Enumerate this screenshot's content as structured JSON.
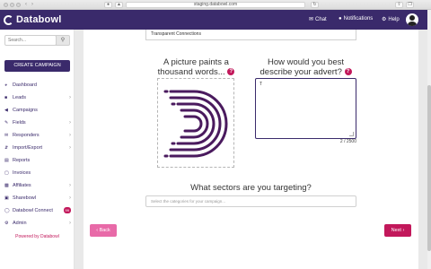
{
  "browser": {
    "url": "staging.databowl.com",
    "back_icon": "chevron-left-icon",
    "forward_icon": "chevron-right-icon"
  },
  "topbar": {
    "app_name": "Databowl",
    "nav": [
      {
        "label": "Chat",
        "icon": "chat-icon"
      },
      {
        "label": "Notifications",
        "icon": "bell-icon"
      },
      {
        "label": "Help",
        "icon": "gear-icon"
      }
    ],
    "brand_color": "#3a2a6b"
  },
  "sidebar": {
    "search_placeholder": "Search...",
    "create_label": "CREATE CAMPAIGN",
    "items": [
      {
        "label": "Dashboard",
        "icon": "dashboard-icon",
        "has_chevron": false
      },
      {
        "label": "Leads",
        "icon": "leads-icon",
        "has_chevron": true
      },
      {
        "label": "Campaigns",
        "icon": "megaphone-icon",
        "has_chevron": false
      },
      {
        "label": "Fields",
        "icon": "fields-icon",
        "has_chevron": true
      },
      {
        "label": "Responders",
        "icon": "envelope-icon",
        "has_chevron": true
      },
      {
        "label": "Import/Export",
        "icon": "import-export-icon",
        "has_chevron": true
      },
      {
        "label": "Reports",
        "icon": "reports-icon",
        "has_chevron": false
      },
      {
        "label": "Invoices",
        "icon": "invoice-icon",
        "has_chevron": false
      },
      {
        "label": "Affiliates",
        "icon": "affiliates-icon",
        "has_chevron": true
      },
      {
        "label": "Sharebowl",
        "icon": "share-icon",
        "has_chevron": true
      },
      {
        "label": "Databowl Connect",
        "icon": "connect-icon",
        "badge": "99"
      },
      {
        "label": "Admin",
        "icon": "admin-gear-icon",
        "has_chevron": true
      }
    ],
    "powered_by": "Powered by Databowl"
  },
  "main": {
    "top_field_value": "Transparent Connections",
    "image_heading": "A picture paints a thousand words...",
    "advert_heading": "How would you best describe your advert?",
    "advert_text": "T",
    "char_counter": "2 / 2500",
    "sectors_heading": "What sectors are you targeting?",
    "sectors_placeholder": "Select the categories for your campaign...",
    "back_label": "Back",
    "next_label": "Next",
    "accent_color": "#c2185b"
  }
}
